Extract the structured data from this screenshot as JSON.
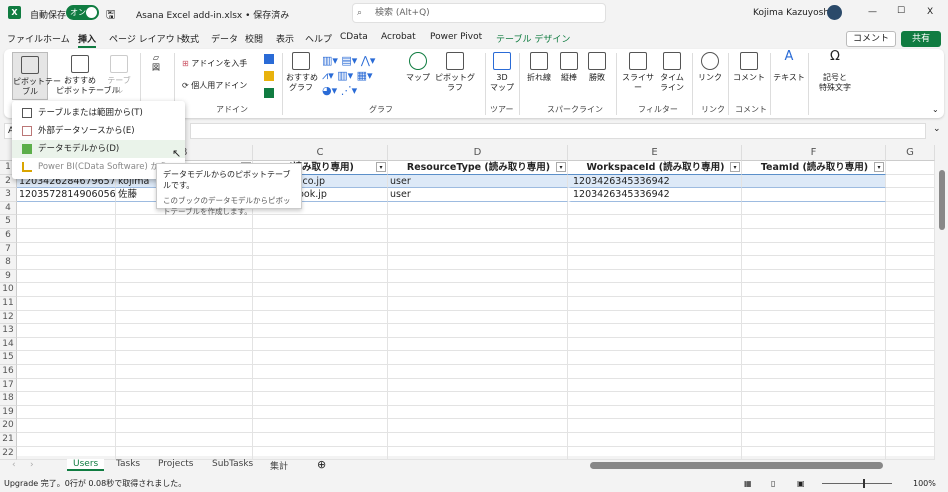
{
  "titlebar": {
    "app_icon": "X",
    "autosave_label": "自動保存",
    "autosave_state": "オン",
    "filename": "Asana Excel add-in.xlsx • 保存済み",
    "search_placeholder": "検索 (Alt+Q)",
    "user": "Kojima Kazuyoshi",
    "minimize": "—",
    "maximize": "☐",
    "close": "X"
  },
  "menu": {
    "tabs": [
      "ファイル",
      "ホーム",
      "挿入",
      "ページ レイアウト",
      "数式",
      "データ",
      "校閲",
      "表示",
      "ヘルプ",
      "CData",
      "Acrobat",
      "Power Pivot",
      "テーブル デザイン"
    ],
    "active": "挿入",
    "comment": "コメント",
    "share": "共有"
  },
  "ribbon": {
    "pivot_table": "ピボットテー\nブル",
    "recommended_pivot": "おすすめ\nピボットテーブル",
    "table": "テーブル",
    "illustrations": "図",
    "get_addins": "アドインを入手",
    "my_addins": "個人用アドイン",
    "addins_group": "アドイン",
    "recommended_charts": "おすすめ\nグラフ",
    "maps": "マップ",
    "pivot_chart": "ピボットグラフ",
    "chart_group": "グラフ",
    "map3d": "3D\nマップ",
    "tour_group": "ツアー",
    "line": "折れ線",
    "column": "縦棒",
    "winloss": "勝敗",
    "sparkline_group": "スパークライン",
    "slicer": "スライサー",
    "timeline": "タイム\nライン",
    "filter_group": "フィルター",
    "link": "リンク",
    "link_group": "リンク",
    "comment": "コメント",
    "comment_group": "コメント",
    "text": "テキスト",
    "symbols": "記号と\n特殊文字"
  },
  "dropdown": {
    "items": [
      "テーブルまたは範囲から(T)",
      "外部データソースから(E)",
      "データモデルから(D)",
      "Power BI(CData Software) から"
    ]
  },
  "tooltip": {
    "title": "データモデルからのピボットテーブルです。",
    "body": "このブックのデータモデルからピボットテーブルを作成します。"
  },
  "namebox": "A",
  "columns": [
    "A",
    "B",
    "C",
    "D",
    "E",
    "F",
    "G"
  ],
  "table": {
    "headers": [
      "",
      "",
      "(読み取り専用)",
      "ResourceType (読み取り専用)",
      "WorkspaceId (読み取り専用)",
      "TeamId (読み取り専用)"
    ],
    "rows": [
      [
        "1203426284679657",
        "kojima",
        "2@yahoo.co.jp",
        "user",
        "1203426345336942",
        ""
      ],
      [
        "1203572814906056",
        "佐藤",
        "ata@outlook.jp",
        "user",
        "1203426345336942",
        ""
      ]
    ]
  },
  "row_numbers": [
    "1",
    "2",
    "3",
    "4",
    "5",
    "6",
    "7",
    "8",
    "9",
    "10",
    "11",
    "12",
    "13",
    "14",
    "15",
    "16",
    "17",
    "18",
    "19",
    "20",
    "21",
    "22"
  ],
  "sheets": [
    "Users",
    "Tasks",
    "Projects",
    "SubTasks",
    "集計"
  ],
  "active_sheet": "Users",
  "status": {
    "message": "Upgrade 完了。0行が 0.08秒で取得されました。",
    "zoom": "100%"
  }
}
